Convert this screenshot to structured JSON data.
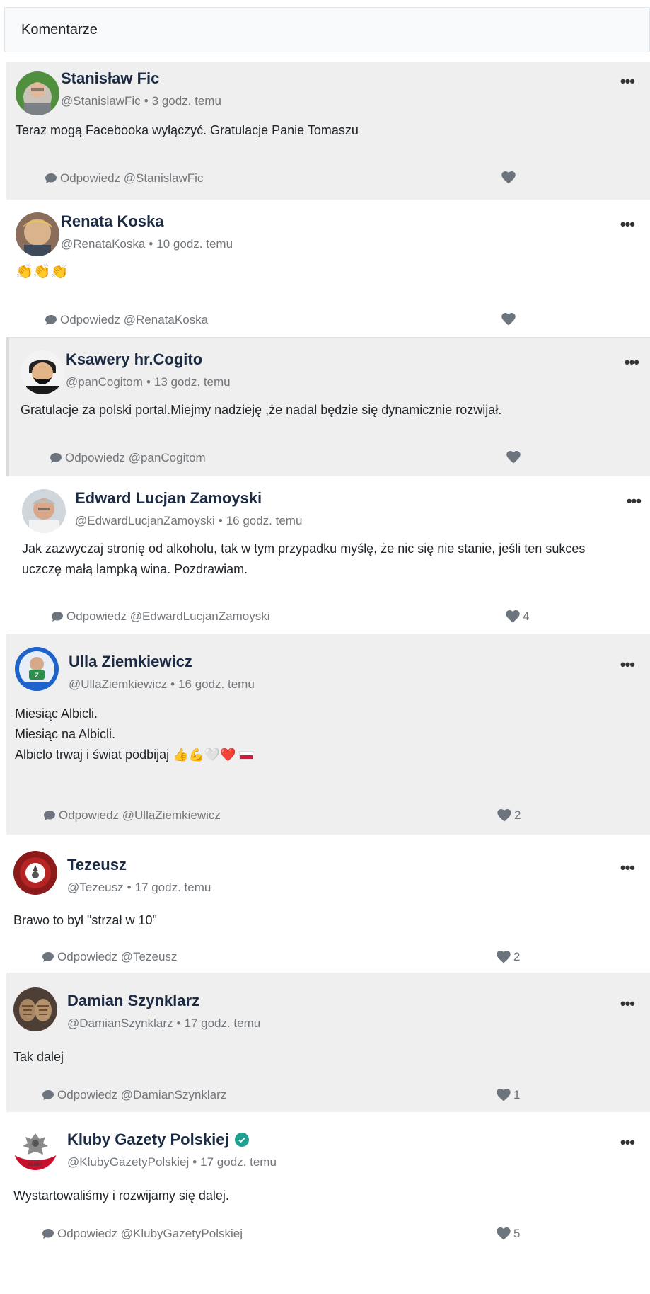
{
  "header": {
    "title": "Komentarze"
  },
  "comments": [
    {
      "author": "Stanisław Fic",
      "handle": "@StanislawFic",
      "time": "3 godz. temu",
      "text": "Teraz mogą Facebooka wyłączyć. Gratulacje Panie Tomaszu",
      "reply_label": "Odpowiedz @StanislawFic",
      "likes": ""
    },
    {
      "author": "Renata Koska",
      "handle": "@RenataKoska",
      "time": "10 godz. temu",
      "text": "👏👏👏",
      "reply_label": "Odpowiedz @RenataKoska",
      "likes": ""
    },
    {
      "author": "Ksawery hr.Cogito",
      "handle": "@panCogitom",
      "time": "13 godz. temu",
      "text": "Gratulacje za polski portal.Miejmy nadzieję ,że nadal będzie się dynamicznie rozwijał.",
      "reply_label": "Odpowiedz @panCogitom",
      "likes": ""
    },
    {
      "author": "Edward Lucjan Zamoyski",
      "handle": "@EdwardLucjanZamoyski",
      "time": "16 godz. temu",
      "text_lines": [
        "Jak zazwyczaj stronię od alkoholu, tak w tym przypadku myślę, że nic się nie stanie, jeśli ten sukces",
        "uczczę małą lampką wina. Pozdrawiam."
      ],
      "reply_label": "Odpowiedz @EdwardLucjanZamoyski",
      "likes": "4"
    },
    {
      "author": "Ulla Ziemkiewicz",
      "handle": "@UllaZiemkiewicz",
      "time": "16 godz. temu",
      "text_lines": [
        "Miesiąc Albicli.",
        "Miesiąc na Albicli.",
        "Albiclo trwaj i świat podbijaj 👍💪🤍❤️"
      ],
      "reply_label": "Odpowiedz @UllaZiemkiewicz",
      "likes": "2"
    },
    {
      "author": "Tezeusz",
      "handle": "@Tezeusz",
      "time": "17 godz. temu",
      "text": "Brawo to był \"strzał w 10\"",
      "reply_label": "Odpowiedz @Tezeusz",
      "likes": "2"
    },
    {
      "author": "Damian Szynklarz",
      "handle": "@DamianSzynklarz",
      "time": "17 godz. temu",
      "text": "Tak dalej",
      "reply_label": "Odpowiedz @DamianSzynklarz",
      "likes": "1"
    },
    {
      "author": "Kluby Gazety Polskiej",
      "handle": "@KlubyGazetyPolskiej",
      "time": "17 godz. temu",
      "text": "Wystartowaliśmy i rozwijamy się dalej.",
      "reply_label": "Odpowiedz @KlubyGazetyPolskiej",
      "likes": "5"
    }
  ],
  "icons": {
    "more": "more-options-icon",
    "reply": "speech-bubble-icon",
    "like": "heart-icon",
    "verified": "verified-check-icon"
  },
  "colors": {
    "author": "#1c2b44",
    "meta": "#72767a",
    "row_gray": "#efefef",
    "verified": "#1fa191"
  }
}
